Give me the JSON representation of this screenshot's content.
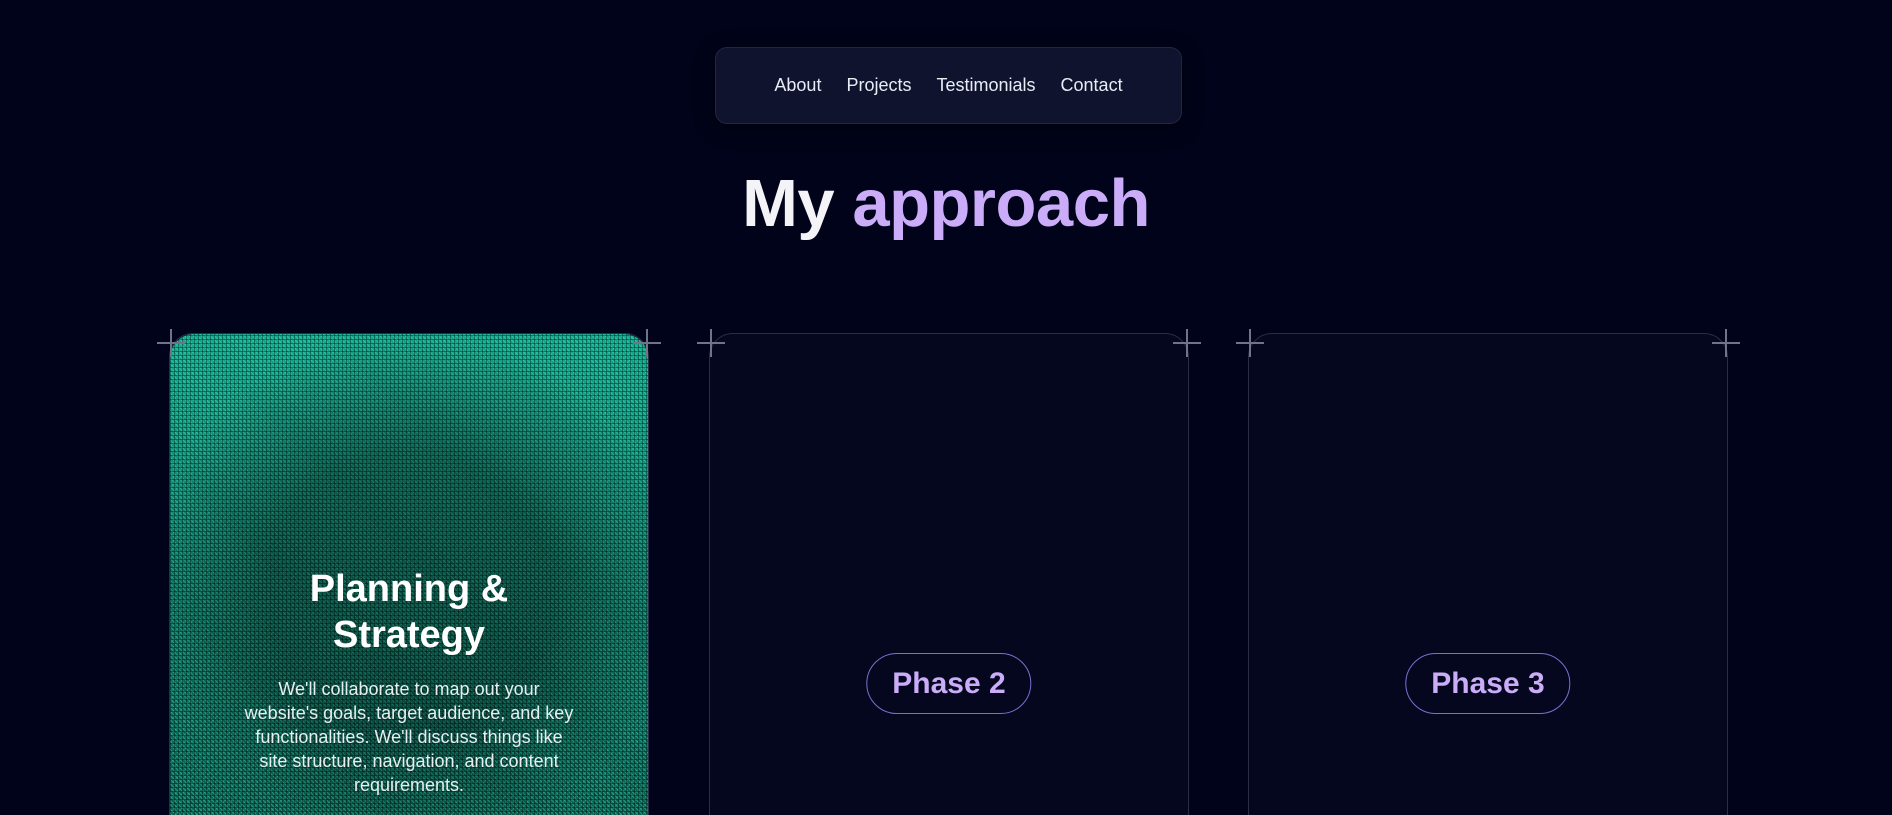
{
  "nav": {
    "items": [
      "About",
      "Projects",
      "Testimonials",
      "Contact"
    ]
  },
  "heading": {
    "plain": "My",
    "accent": "approach"
  },
  "cards": [
    {
      "title": "Planning & Strategy",
      "description": "We'll collaborate to map out your website's goals, target audience, and key functionalities. We'll discuss things like site structure, navigation, and content requirements."
    },
    {
      "phase_label": "Phase 2"
    },
    {
      "phase_label": "Phase 3"
    }
  ],
  "colors": {
    "background": "#000319",
    "accent": "#cbacf9",
    "card_active": "#0d7a66",
    "phase_border": "#7d6fd1"
  },
  "icons": [
    "plus-corner-icon"
  ]
}
